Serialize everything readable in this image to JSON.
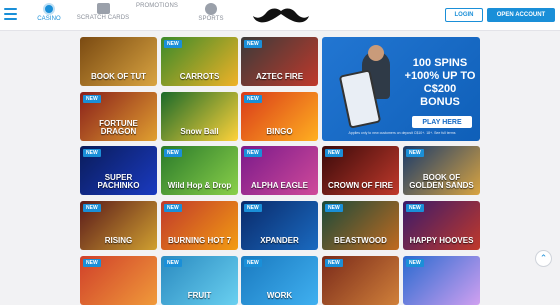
{
  "nav": [
    {
      "label": "CASINO",
      "active": true,
      "icon": "casino-icon"
    },
    {
      "label": "SCRATCH CARDS",
      "active": false,
      "icon": "scratch-cards-icon"
    },
    {
      "label": "PROMOTIONS",
      "active": false,
      "icon": "gift-icon"
    },
    {
      "label": "SPORTS",
      "active": false,
      "icon": "soccer-ball-icon"
    }
  ],
  "header": {
    "login_label": "LOGIN",
    "open_account_label": "OPEN ACCOUNT",
    "brand_color": "#1a8fd8"
  },
  "promo": {
    "line1": "100 SPINS",
    "line2": "+100% UP TO",
    "line3": "C$200",
    "line4": "BONUS",
    "cta": "PLAY HERE",
    "terms": "Applies only to new customers on deposit C$10+. 18+. See full terms"
  },
  "games": [
    {
      "name": "BOOK OF TUT",
      "badge": ""
    },
    {
      "name": "CARROTS",
      "badge": "NEW"
    },
    {
      "name": "AZTEC FIRE",
      "badge": "NEW"
    },
    {
      "name": "FORTUNE DRAGON",
      "badge": "NEW"
    },
    {
      "name": "Snow Ball",
      "badge": ""
    },
    {
      "name": "BINGO",
      "badge": "NEW"
    },
    {
      "name": "SUPER PACHINKO",
      "badge": "NEW"
    },
    {
      "name": "Wild Hop & Drop",
      "badge": "NEW"
    },
    {
      "name": "ALPHA EAGLE",
      "badge": "NEW"
    },
    {
      "name": "CROWN OF FIRE",
      "badge": "NEW"
    },
    {
      "name": "BOOK OF GOLDEN SANDS",
      "badge": "NEW"
    },
    {
      "name": "RISING",
      "badge": "NEW"
    },
    {
      "name": "BURNING HOT 7",
      "badge": "NEW"
    },
    {
      "name": "XPANDER",
      "badge": "NEW"
    },
    {
      "name": "BEASTWOOD",
      "badge": "NEW"
    },
    {
      "name": "HAPPY HOOVES",
      "badge": "NEW"
    },
    {
      "name": "",
      "badge": "NEW"
    },
    {
      "name": "FRUIT",
      "badge": "NEW"
    },
    {
      "name": "WORK",
      "badge": "NEW"
    },
    {
      "name": "",
      "badge": "NEW"
    },
    {
      "name": "",
      "badge": "NEW"
    }
  ]
}
